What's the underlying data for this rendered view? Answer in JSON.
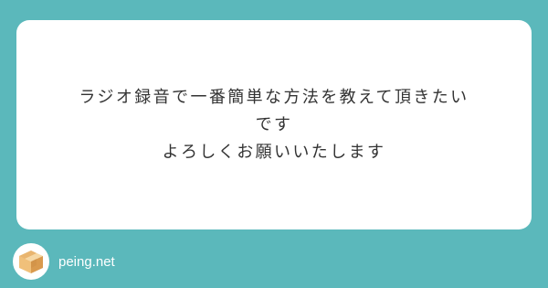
{
  "card": {
    "question_lines": [
      "ラジオ録音で一番簡単な方法を教えて頂きたい",
      "です",
      "よろしくお願いいたします"
    ]
  },
  "footer": {
    "brand": "peing.net",
    "logo_icon": "cardboard-box-icon"
  },
  "colors": {
    "background": "#5bb8bb",
    "card": "#ffffff",
    "text": "#333333",
    "box_light": "#f3c98a",
    "box_dark": "#d99a4e"
  }
}
